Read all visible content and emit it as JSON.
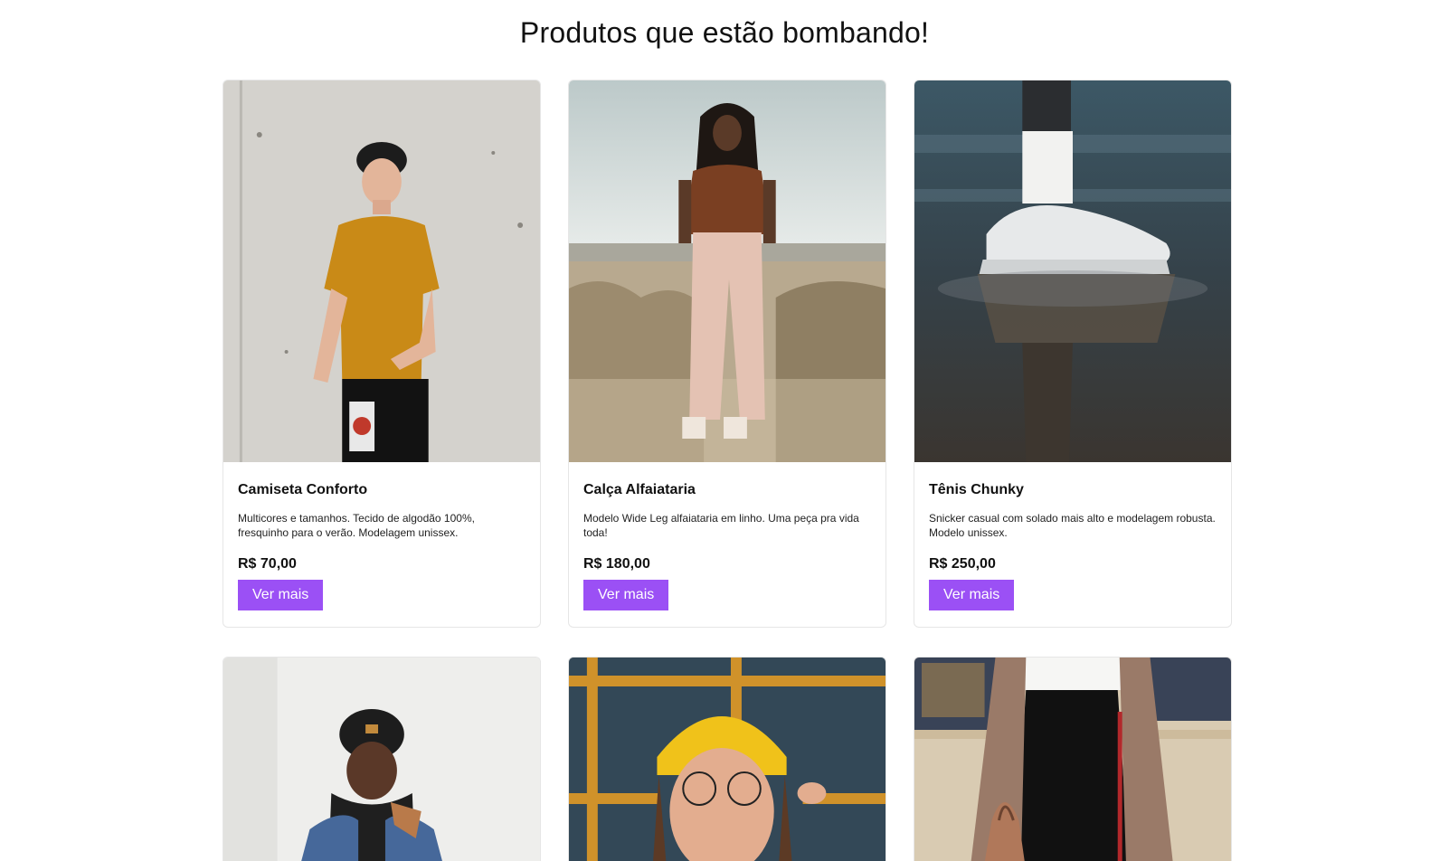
{
  "section": {
    "title": "Produtos que estão bombando!"
  },
  "products": [
    {
      "name": "Camiseta Conforto",
      "description": "Multicores e tamanhos. Tecido de algodão 100%, fresquinho para o verão. Modelagem unissex.",
      "price": "R$ 70,00",
      "cta": "Ver mais",
      "image": "man-mustard-tshirt-concrete-wall"
    },
    {
      "name": "Calça Alfaiataria",
      "description": "Modelo Wide Leg alfaiataria em linho. Uma peça pra vida toda!",
      "price": "R$ 180,00",
      "cta": "Ver mais",
      "image": "woman-wide-leg-pants-field"
    },
    {
      "name": "Tênis Chunky",
      "description": "Snicker casual com solado mais alto e modelagem robusta. Modelo unissex.",
      "price": "R$ 250,00",
      "cta": "Ver mais",
      "image": "chunky-sneaker-puddle-reflection"
    },
    {
      "image": "man-beanie-denim-jacket"
    },
    {
      "image": "woman-yellow-beanie-glasses"
    },
    {
      "image": "coat-handbag-street"
    }
  ],
  "colors": {
    "button": "#9b50f5",
    "card_border": "#e6e6e6"
  }
}
